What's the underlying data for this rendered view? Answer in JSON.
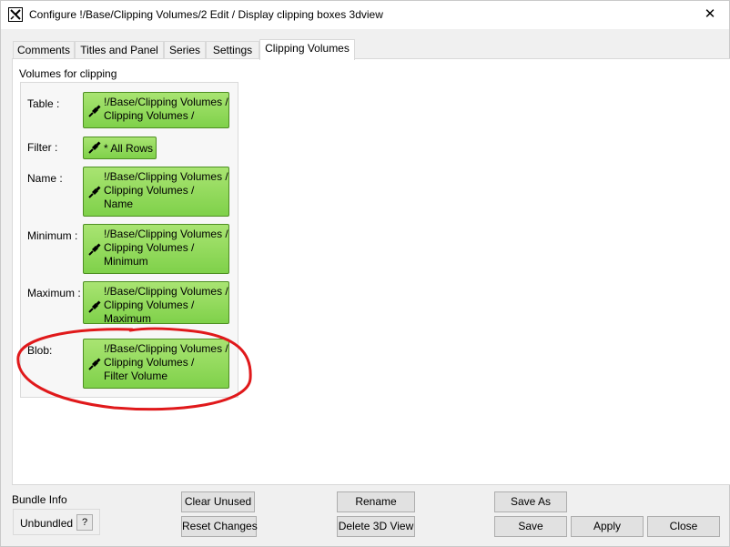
{
  "window": {
    "title": "Configure !/Base/Clipping Volumes/2 Edit / Display clipping boxes 3dview",
    "close_glyph": "✕"
  },
  "tabs": [
    {
      "label": "Comments"
    },
    {
      "label": "Titles and Panel"
    },
    {
      "label": "Series"
    },
    {
      "label": "Settings"
    },
    {
      "label": "Clipping Volumes"
    }
  ],
  "panel": {
    "group_title": "Volumes for clipping",
    "fields": {
      "table": {
        "label": "Table :",
        "lines": [
          "!/Base/Clipping Volumes /",
          "Clipping Volumes /"
        ]
      },
      "filter": {
        "label": "Filter :",
        "lines": [
          "* All Rows"
        ]
      },
      "name": {
        "label": "Name :",
        "lines": [
          "!/Base/Clipping Volumes /",
          "Clipping Volumes /",
          "Name"
        ]
      },
      "minimum": {
        "label": "Minimum :",
        "lines": [
          "!/Base/Clipping Volumes /",
          "Clipping Volumes /",
          "Minimum"
        ]
      },
      "maximum": {
        "label": "Maximum :",
        "lines": [
          "!/Base/Clipping Volumes /",
          "Clipping Volumes /",
          "Maximum"
        ]
      },
      "blob": {
        "label": "Blob:",
        "lines": [
          "!/Base/Clipping Volumes /",
          "Clipping Volumes /",
          "Filter Volume"
        ]
      }
    }
  },
  "bottom": {
    "bundle_info_label": "Bundle Info",
    "bundle_value": "Unbundled",
    "help_label": "?",
    "clear_unused": "Clear Unused",
    "reset_changes": "Reset Changes",
    "rename": "Rename",
    "delete_3d_view": "Delete 3D View",
    "save_as": "Save As",
    "save": "Save",
    "apply": "Apply",
    "close": "Close"
  },
  "colors": {
    "green_button_top": "#a9e472",
    "green_button_bottom": "#7fd14a",
    "annotation_red": "#e0191b"
  }
}
